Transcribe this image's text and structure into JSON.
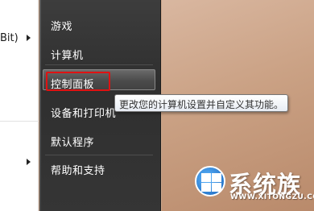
{
  "left_pane": {
    "items": [
      {
        "label": "Bit)",
        "has_arrow": true
      },
      {
        "label": "",
        "has_arrow": true
      }
    ]
  },
  "start_menu": {
    "items": [
      {
        "id": "games",
        "label": "游戏"
      },
      {
        "id": "computer",
        "label": "计算机"
      },
      {
        "id": "control-panel",
        "label": "控制面板",
        "highlighted": true
      },
      {
        "id": "devices-printers",
        "label": "设备和打印机"
      },
      {
        "id": "default-programs",
        "label": "默认程序"
      },
      {
        "id": "help-support",
        "label": "帮助和支持"
      }
    ]
  },
  "tooltip": {
    "text": "更改您的计算机设置并自定义其功能。"
  },
  "watermark": {
    "brand": "系统族",
    "url": "WWW.XITONGZU.COM"
  },
  "colors": {
    "menu_bg": "#353535",
    "highlight_border": "#e01212",
    "desktop": "#caa184"
  }
}
